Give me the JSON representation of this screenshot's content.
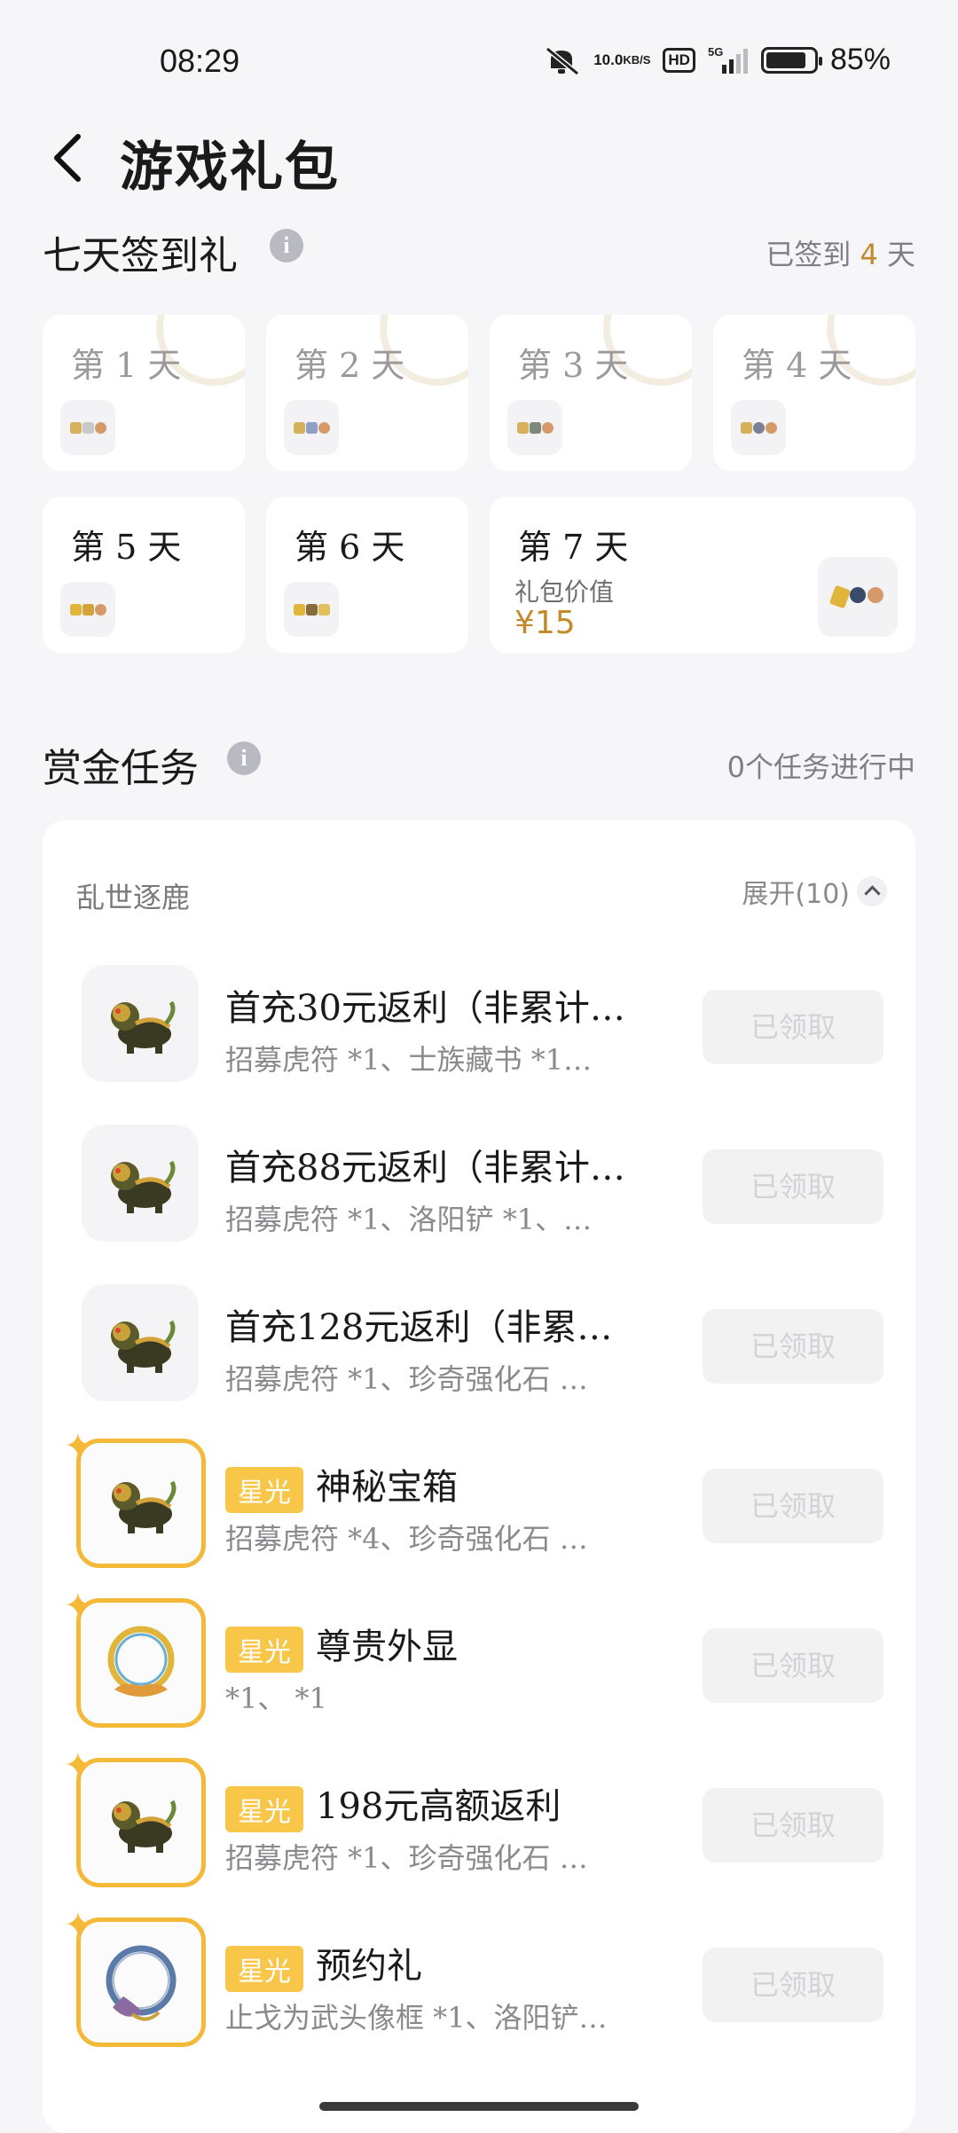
{
  "status": {
    "time": "08:29",
    "speed_value": "10.0",
    "speed_unit": "KB/S",
    "hd": "HD",
    "network": "5G",
    "battery": "85%",
    "battery_level": 0.85
  },
  "header": {
    "title": "游戏礼包"
  },
  "signin": {
    "title": "七天签到礼",
    "meta_prefix": "已签到 ",
    "meta_count": "4",
    "meta_suffix": " 天",
    "days": [
      {
        "label": "第 1 天",
        "done": true
      },
      {
        "label": "第 2 天",
        "done": true
      },
      {
        "label": "第 3 天",
        "done": true
      },
      {
        "label": "第 4 天",
        "done": true
      },
      {
        "label": "第 5 天",
        "done": false
      },
      {
        "label": "第 6 天",
        "done": false
      }
    ],
    "day7": {
      "label": "第 7 天",
      "value_label": "礼包价值",
      "value": "¥15"
    }
  },
  "bounty": {
    "title": "赏金任务",
    "meta": "0个任务进行中",
    "group": "乱世逐鹿",
    "expand": "展开(10)",
    "tasks": [
      {
        "title": "首充30元返利（非累计…",
        "desc": "招募虎符 *1、士族藏书 *1…",
        "button": "已领取",
        "icon": "lion-icon",
        "star": false
      },
      {
        "title": "首充88元返利（非累计…",
        "desc": "招募虎符 *1、洛阳铲 *1、…",
        "button": "已领取",
        "icon": "lion-icon",
        "star": false
      },
      {
        "title": "首充128元返利（非累…",
        "desc": "招募虎符 *1、珍奇强化石 …",
        "button": "已领取",
        "icon": "lion-icon",
        "star": false
      },
      {
        "badge": "星光",
        "title": "神秘宝箱",
        "desc": "招募虎符 *4、珍奇强化石 …",
        "button": "已领取",
        "icon": "lion-icon",
        "star": true
      },
      {
        "badge": "星光",
        "title": "尊贵外显",
        "desc": " *1、 *1",
        "button": "已领取",
        "icon": "golden-frame-icon",
        "star": true
      },
      {
        "badge": "星光",
        "title": "198元高额返利",
        "desc": "招募虎符 *1、珍奇强化石 …",
        "button": "已领取",
        "icon": "lion-icon",
        "star": true
      },
      {
        "badge": "星光",
        "title": "预约礼",
        "desc": "止戈为武头像框 *1、洛阳铲…",
        "button": "已领取",
        "icon": "blue-frame-icon",
        "star": true
      }
    ]
  },
  "colors": {
    "accent": "#c48a2a",
    "star": "#f5b93a",
    "badge": "#f8c648",
    "background": "#f6f6f8"
  }
}
